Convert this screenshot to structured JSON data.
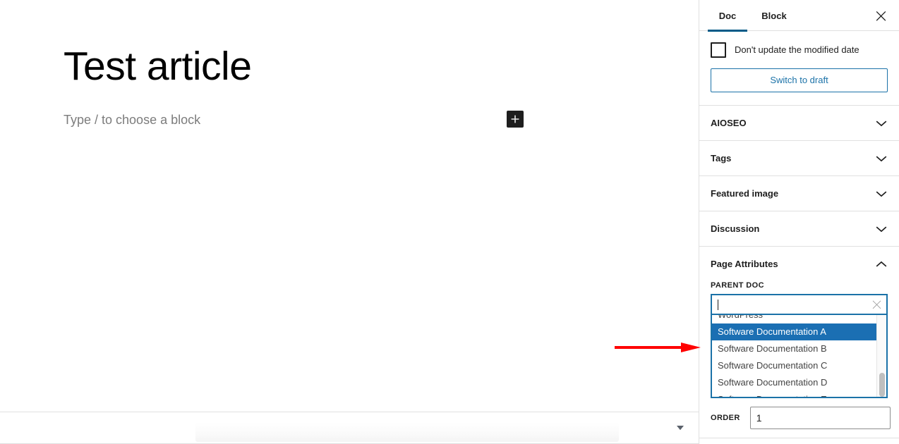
{
  "editor": {
    "post_title": "Test article",
    "block_placeholder": "Type / to choose a block",
    "inserter_icon": "plus-icon",
    "bottom_caret_icon": "caret-down-icon"
  },
  "sidebar": {
    "tabs": [
      {
        "label": "Doc",
        "active": true
      },
      {
        "label": "Block",
        "active": false
      }
    ],
    "close_icon": "close-icon",
    "status": {
      "checkbox_label": "Don't update the modified date",
      "checkbox_checked": false,
      "switch_to_draft_label": "Switch to draft"
    },
    "panels": [
      {
        "title": "AIOSEO",
        "expanded": false,
        "chevron": "chevron-down-icon"
      },
      {
        "title": "Tags",
        "expanded": false,
        "chevron": "chevron-down-icon"
      },
      {
        "title": "Featured image",
        "expanded": false,
        "chevron": "chevron-down-icon"
      },
      {
        "title": "Discussion",
        "expanded": false,
        "chevron": "chevron-down-icon"
      },
      {
        "title": "Page Attributes",
        "expanded": true,
        "chevron": "chevron-up-icon"
      }
    ],
    "page_attributes": {
      "parent_doc_label": "PARENT DOC",
      "parent_doc_value": "",
      "parent_doc_placeholder": "",
      "clear_icon": "close-small-icon",
      "options": [
        {
          "label": "WordPress",
          "selected": false,
          "clipped": "top"
        },
        {
          "label": "Software Documentation A",
          "selected": true
        },
        {
          "label": "Software Documentation B",
          "selected": false
        },
        {
          "label": "Software Documentation C",
          "selected": false
        },
        {
          "label": "Software Documentation D",
          "selected": false
        },
        {
          "label": "Software Documentation E",
          "selected": false,
          "clipped": "bottom"
        }
      ],
      "order_label": "ORDER",
      "order_value": "1"
    }
  },
  "annotation": {
    "type": "arrow",
    "direction": "right",
    "color": "#ff0000",
    "points_to": "Software Documentation A"
  },
  "colors": {
    "accent_blue": "#1b72a8",
    "tab_underline": "#005a87",
    "selection_blue": "#1b6fb3",
    "border_grey": "#e0e0e0",
    "text_primary": "#1e1e1e",
    "text_muted": "#7c7c7c",
    "annotation_red": "#ff0000",
    "inserter_dark": "#1e1e1e"
  }
}
